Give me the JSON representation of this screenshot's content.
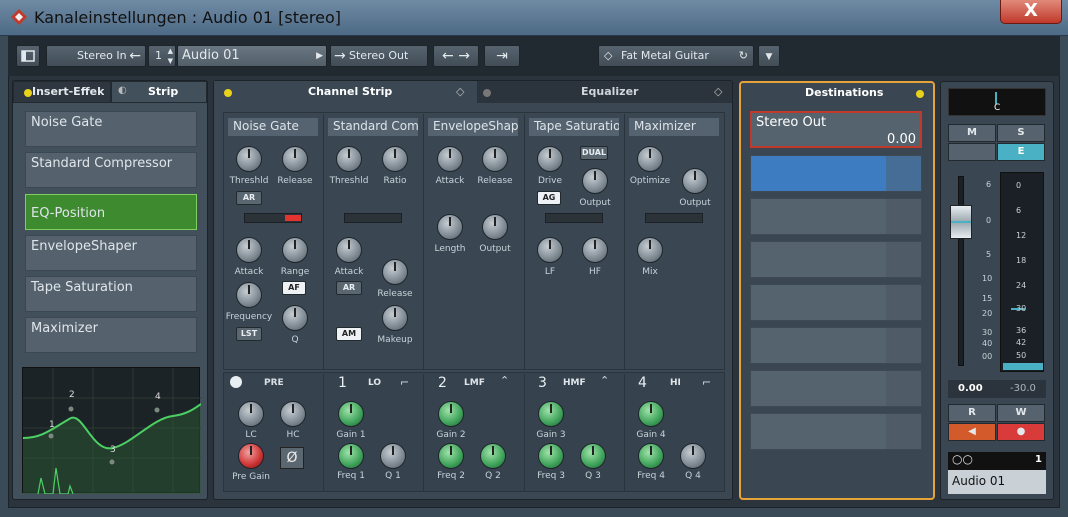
{
  "window": {
    "title": "Kanaleinstellungen : Audio 01 [stereo]",
    "close_label": "X"
  },
  "toolbar": {
    "input": "Stereo In",
    "channel_number": "1",
    "channel_name": "Audio 01",
    "output": "Stereo Out",
    "preset": "Fat Metal Guitar"
  },
  "left_panel": {
    "tab_inserts": "Insert-Effekte",
    "tab_strip": "Strip",
    "inserts": [
      "Noise Gate",
      "Standard Compressor",
      "EQ-Position",
      "EnvelopeShaper",
      "Tape Saturation",
      "Maximizer"
    ],
    "graph_points": [
      "1",
      "2",
      "3",
      "4"
    ]
  },
  "center_tabs": {
    "channel_strip": "Channel Strip",
    "equalizer": "Equalizer"
  },
  "modules": {
    "noise_gate": {
      "title": "Noise Gate",
      "threshold": "Threshld",
      "release": "Release",
      "ar": "AR",
      "attack": "Attack",
      "range": "Range",
      "af": "AF",
      "frequency": "Frequency",
      "lst": "LST",
      "q": "Q"
    },
    "compressor": {
      "title": "Standard Comp",
      "threshold": "Threshld",
      "ratio": "Ratio",
      "attack": "Attack",
      "ar": "AR",
      "release": "Release",
      "am": "AM",
      "makeup": "Makeup"
    },
    "envelope": {
      "title": "EnvelopeShape",
      "attack": "Attack",
      "release": "Release",
      "length": "Length",
      "output": "Output"
    },
    "tape": {
      "title": "Tape Saturation",
      "drive": "Drive",
      "output": "Output",
      "dual": "DUAL",
      "ag": "AG",
      "lf": "LF",
      "hf": "HF"
    },
    "maximizer": {
      "title": "Maximizer",
      "optimize": "Optimize",
      "output": "Output",
      "mix": "Mix"
    }
  },
  "eq": {
    "pre": {
      "label": "PRE",
      "lc": "LC",
      "hc": "HC",
      "pre_gain": "Pre Gain",
      "phase_icon": "Ø"
    },
    "bands": [
      {
        "num": "1",
        "name": "LO",
        "gain": "Gain 1",
        "freq": "Freq 1",
        "q": "Q 1"
      },
      {
        "num": "2",
        "name": "LMF",
        "gain": "Gain 2",
        "freq": "Freq 2",
        "q": "Q 2"
      },
      {
        "num": "3",
        "name": "HMF",
        "gain": "Gain 3",
        "freq": "Freq 3",
        "q": "Q 3"
      },
      {
        "num": "4",
        "name": "HI",
        "gain": "Gain 4",
        "freq": "Freq 4",
        "q": "Q 4"
      }
    ]
  },
  "destinations": {
    "title": "Destinations",
    "first_name": "Stereo Out",
    "first_value": "0.00"
  },
  "fader": {
    "pan": "C",
    "mute": "M",
    "solo": "S",
    "edit": "E",
    "read": "R",
    "write": "W",
    "volume": "0.00",
    "peak": "-30.0",
    "channel_name": "Audio 01",
    "channel_index": "1",
    "fader_scale": [
      "6",
      "0",
      "5",
      "10",
      "15",
      "20",
      "30",
      "40",
      "00"
    ],
    "meter_scale": [
      "0",
      "6",
      "12",
      "18",
      "24",
      "30",
      "36",
      "42",
      "50"
    ]
  },
  "colors": {
    "accent_green": "#3e8a2f",
    "selected_blue": "#3d7cc0",
    "dest_border": "#c0392b",
    "frame_orange": "#e6a33a",
    "lit_cyan": "#4ab0c4"
  }
}
